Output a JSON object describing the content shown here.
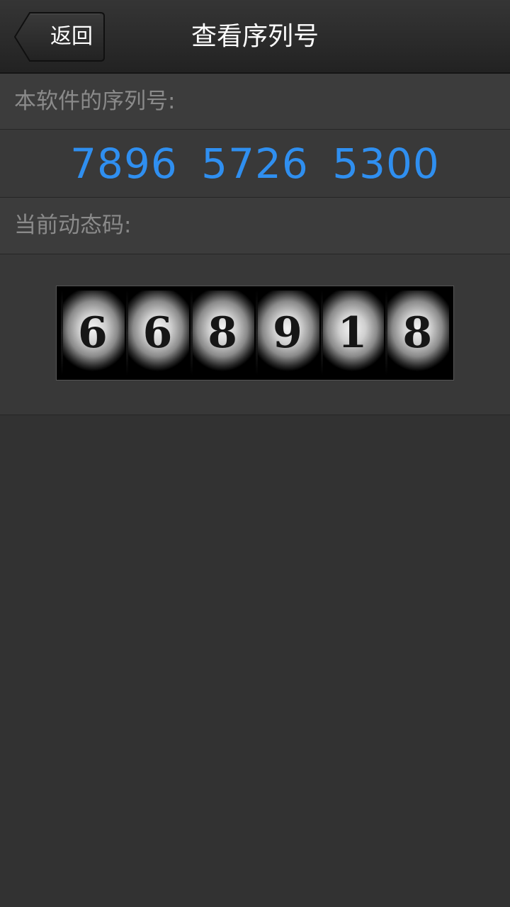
{
  "navbar": {
    "back_label": "返回",
    "title": "查看序列号"
  },
  "serial": {
    "label": "本软件的序列号:",
    "value": "7896 5726 5300",
    "color": "#2f8ff0"
  },
  "dynamic_code": {
    "label": "当前动态码:",
    "digits": [
      "6",
      "6",
      "8",
      "9",
      "1",
      "8"
    ]
  },
  "icons": {
    "back": "back-arrow-button-shape"
  }
}
